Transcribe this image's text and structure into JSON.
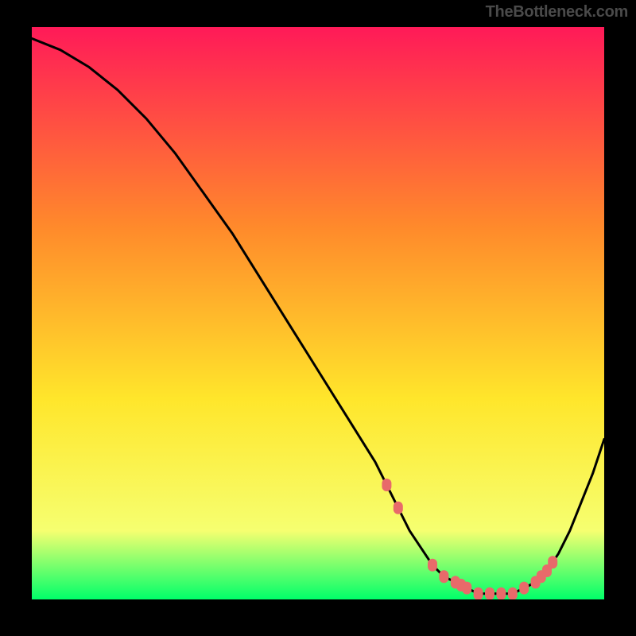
{
  "attribution": "TheBottleneck.com",
  "chart_data": {
    "type": "line",
    "title": "",
    "xlabel": "",
    "ylabel": "",
    "xlim": [
      0,
      100
    ],
    "ylim": [
      0,
      100
    ],
    "x": [
      0,
      5,
      10,
      15,
      20,
      25,
      30,
      35,
      40,
      45,
      50,
      55,
      60,
      62,
      64,
      66,
      68,
      70,
      72,
      74,
      76,
      78,
      80,
      82,
      84,
      86,
      88,
      90,
      92,
      94,
      96,
      98,
      100
    ],
    "y": [
      98,
      96,
      93,
      89,
      84,
      78,
      71,
      64,
      56,
      48,
      40,
      32,
      24,
      20,
      16,
      12,
      9,
      6,
      4,
      3,
      2,
      1,
      1,
      1,
      1,
      2,
      3,
      5,
      8,
      12,
      17,
      22,
      28
    ],
    "highlight_zone": {
      "x_start": 62,
      "x_end": 92
    },
    "dot_x": [
      62,
      64,
      70,
      72,
      74,
      75,
      76,
      78,
      80,
      82,
      84,
      86,
      88,
      89,
      90,
      91
    ],
    "background_gradient": {
      "top": "#ff1a58",
      "mid1": "#ff8a2b",
      "mid2": "#ffe62b",
      "mid3": "#f6ff70",
      "bottom": "#00ff6a"
    }
  }
}
